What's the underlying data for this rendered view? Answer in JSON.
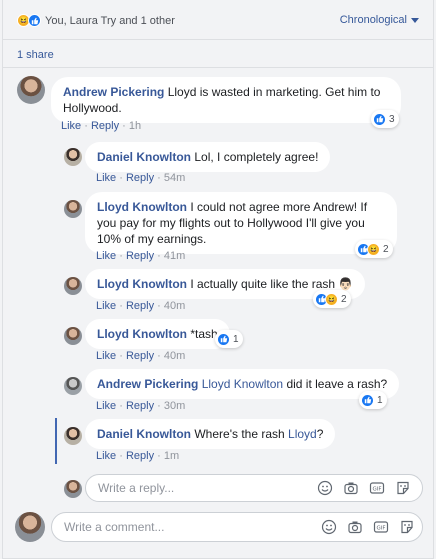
{
  "summary": {
    "text": "You, Laura Try and 1 other",
    "reactions": [
      "haha",
      "like"
    ]
  },
  "sort": {
    "label": "Chronological"
  },
  "shares": {
    "label": "1 share"
  },
  "comments": [
    {
      "author": "Andrew Pickering",
      "text": "Lloyd is wasted in marketing. Get him to Hollywood.",
      "like": "Like",
      "reply": "Reply",
      "time": "1h",
      "reactions": [
        "like"
      ],
      "count": "3"
    },
    {
      "author": "Daniel Knowlton",
      "text": "Lol, I completely agree!",
      "like": "Like",
      "reply": "Reply",
      "time": "54m"
    },
    {
      "author": "Lloyd Knowlton",
      "text": "I could not agree more Andrew! If you pay for my flights out to Hollywood I'll give you 10% of my earnings.",
      "like": "Like",
      "reply": "Reply",
      "time": "41m",
      "reactions": [
        "like",
        "haha"
      ],
      "count": "2"
    },
    {
      "author": "Lloyd Knowlton",
      "text": "I actually quite like the rash 👨🏻",
      "like": "Like",
      "reply": "Reply",
      "time": "40m",
      "reactions": [
        "like",
        "haha"
      ],
      "count": "2"
    },
    {
      "author": "Lloyd Knowlton",
      "text": "*tash",
      "like": "Like",
      "reply": "Reply",
      "time": "40m",
      "reactions": [
        "like"
      ],
      "count": "1"
    },
    {
      "author": "Andrew Pickering",
      "tag": "Lloyd Knowlton",
      "text": "did it leave a rash?",
      "like": "Like",
      "reply": "Reply",
      "time": "30m",
      "reactions": [
        "like"
      ],
      "count": "1"
    },
    {
      "author": "Daniel Knowlton",
      "text": "Where's the rash",
      "tag": "Lloyd",
      "suffix": "?",
      "like": "Like",
      "reply": "Reply",
      "time": "1m"
    }
  ],
  "reply_input": {
    "placeholder": "Write a reply..."
  },
  "comment_input": {
    "placeholder": "Write a comment..."
  },
  "icons": [
    "haha-icon",
    "like-icon",
    "emoji-icon",
    "camera-icon",
    "gif-icon",
    "sticker-icon"
  ],
  "colors": {
    "link": "#385898",
    "like": "#1877f2",
    "thread": "#4267b2"
  }
}
